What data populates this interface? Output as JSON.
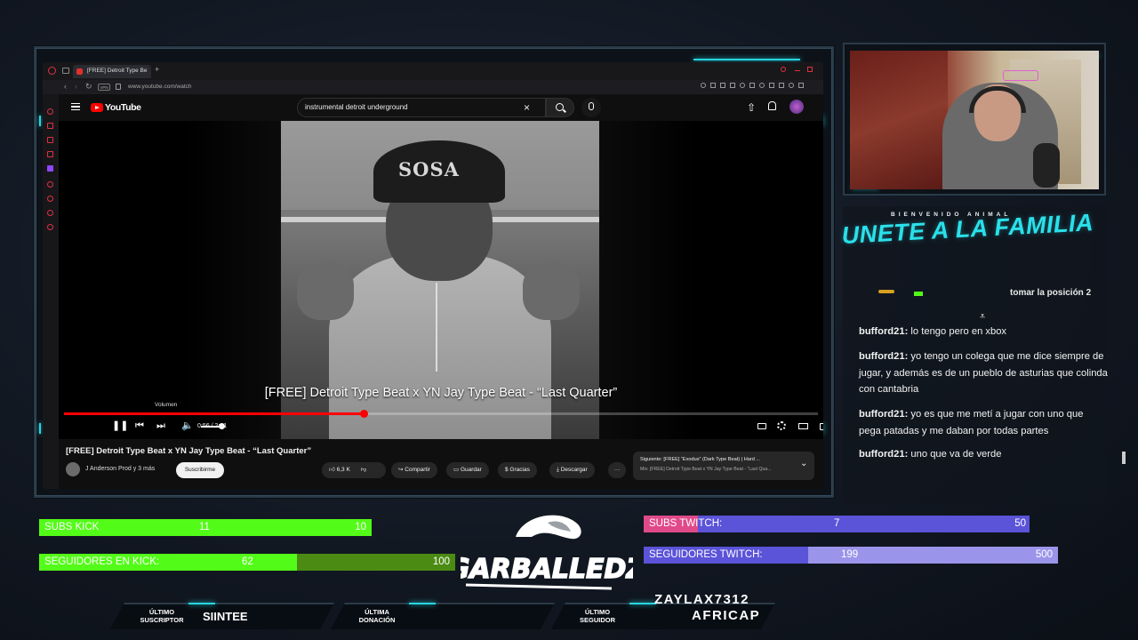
{
  "browser": {
    "tab_title": "[FREE] Detroit Type Be",
    "url": "www.youtube.com/watch"
  },
  "youtube": {
    "logo_text": "YouTube",
    "search_value": "instrumental detroit underground",
    "video_overlay_title": "[FREE] Detroit Type Beat x YN Jay Type Beat - “Last Quarter”",
    "thumbnail_hat_text": "SOSA",
    "volume_tooltip": "Volumen",
    "time": "0:56 / 2:21",
    "progress_fraction": 0.397,
    "video_title": "[FREE] Detroit Type Beat x YN Jay Type Beat - “Last Quarter”",
    "channel": "J Anderson Prod y 3 más",
    "subscribe": "Suscribirme",
    "likes": "6,3 K",
    "share": "Compartir",
    "save": "Guardar",
    "thanks": "Gracias",
    "download": "Descargar",
    "next_line1": "Siguiente: [FREE] “Exodus” (Dark Type Beat) | Hard ...",
    "next_line2": "Mix: [FREE] Detroit Type Beat x YN Jay Type Beat - “Last Qua..."
  },
  "overlay": {
    "welcome_small": "BIENVENIDO ANIMAL",
    "join_title": "UNETE A LA FAMILIA",
    "chat_cut_text": "tomar la posición 2",
    "chat": [
      {
        "user": "bufford21:",
        "text": "lo tengo pero en xbox"
      },
      {
        "user": "bufford21:",
        "text": "yo tengo un colega que me dice siempre de jugar, y además es de un pueblo de asturias que colinda con cantabria"
      },
      {
        "user": "bufford21:",
        "text": "yo es que me metí a jugar con uno que pega patadas y me daban por todas partes"
      },
      {
        "user": "bufford21:",
        "text": "uno que va de verde"
      }
    ]
  },
  "goals": {
    "subs_kick": {
      "label": "SUBS KICK",
      "current": "11",
      "goal": "10",
      "fraction": 1.0
    },
    "seg_kick": {
      "label": "SEGUIDORES EN KICK:",
      "current": "62",
      "goal": "100",
      "fraction": 0.62
    },
    "subs_twitch": {
      "label": "SUBS TWITCH:",
      "current": "7",
      "goal": "50",
      "fraction": 0.14
    },
    "seg_twitch": {
      "label": "SEGUIDORES TWITCH:",
      "current": "199",
      "goal": "500",
      "fraction": 0.398
    }
  },
  "logo_text": "GARBALLEDZ",
  "bottom": {
    "last_sub_label_1": "ÚLTIMO",
    "last_sub_label_2": "SUSCRIPTOR",
    "last_sub_value": "SIINTEE",
    "last_don_label_1": "ÚLTIMA",
    "last_don_label_2": "DONACIÓN",
    "last_don_value": "",
    "last_fol_label_1": "ÚLTIMO",
    "last_fol_label_2": "SEGUIDOR",
    "last_fol_value_1": "ZAYLAX7312",
    "last_fol_value_2": "AFRICAP"
  },
  "colors": {
    "kick_green": "#53fc18",
    "kick_dark": "#4b8b14",
    "twitch_purple": "#5b53d8",
    "twitch_light": "#9a95ea",
    "accent_cyan": "#28d6e0",
    "yt_red": "#ff0000"
  }
}
